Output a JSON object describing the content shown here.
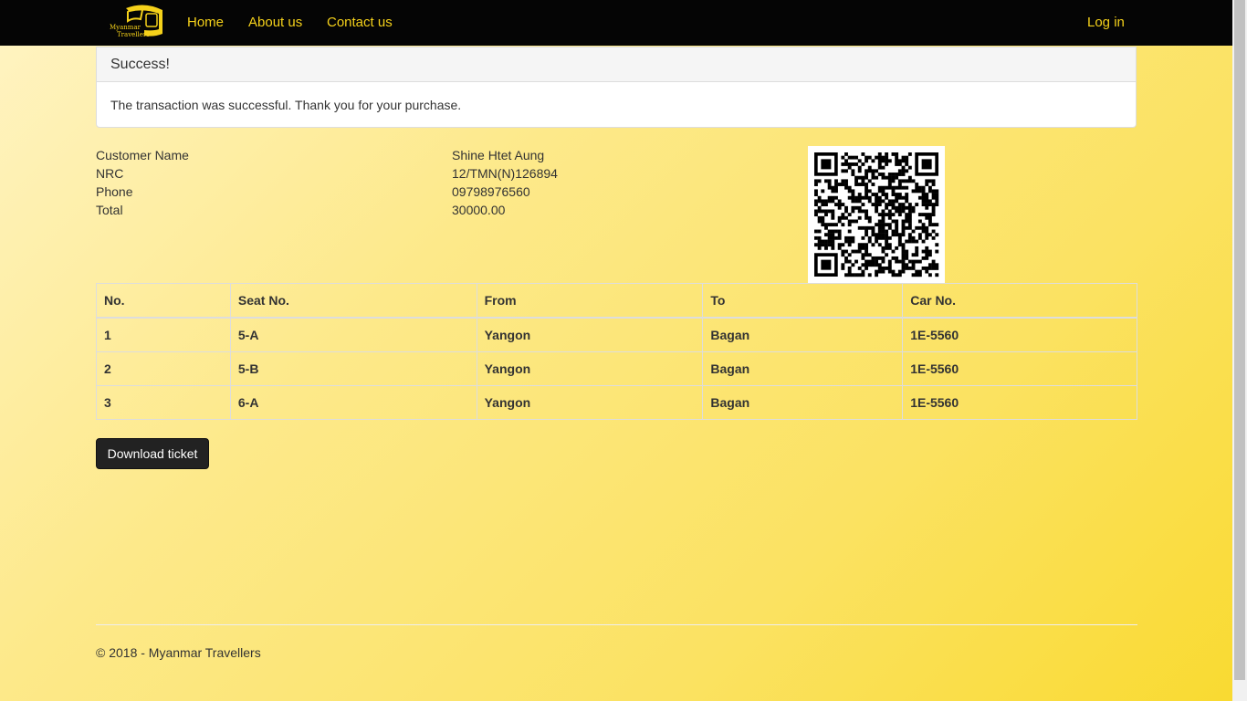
{
  "nav": {
    "brand_line1": "Myanmar",
    "brand_line2": "Travellers",
    "links": [
      "Home",
      "About us",
      "Contact us"
    ],
    "login": "Log in"
  },
  "alert": {
    "title": "Success!",
    "message": "The transaction was successful. Thank you for your purchase."
  },
  "customer": {
    "name_label": "Customer Name",
    "name": "Shine Htet Aung",
    "nrc_label": "NRC",
    "nrc": "12/TMN(N)126894",
    "phone_label": "Phone",
    "phone": "09798976560",
    "total_label": "Total",
    "total": "30000.00"
  },
  "table": {
    "headers": [
      "No.",
      "Seat No.",
      "From",
      "To",
      "Car No."
    ],
    "rows": [
      [
        "1",
        "5-A",
        "Yangon",
        "Bagan",
        "1E-5560"
      ],
      [
        "2",
        "5-B",
        "Yangon",
        "Bagan",
        "1E-5560"
      ],
      [
        "3",
        "6-A",
        "Yangon",
        "Bagan",
        "1E-5560"
      ]
    ]
  },
  "download_button": "Download ticket",
  "footer": "© 2018 - Myanmar Travellers",
  "colors": {
    "nav_bg": "#050505",
    "nav_link": "#f5d11a",
    "button_bg": "#222222"
  }
}
